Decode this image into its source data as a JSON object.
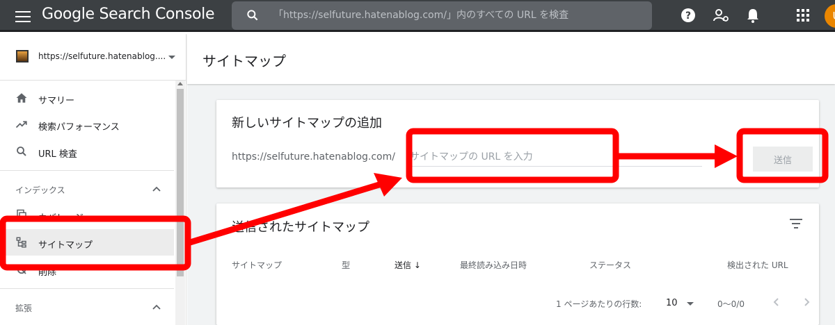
{
  "app": {
    "brand_google": "Google",
    "brand_product": "Search Console",
    "user_initial": "U"
  },
  "search": {
    "placeholder": "「https://selfuture.hatenablog.com/」内のすべての URL を検査"
  },
  "top_icons": [
    "help-icon",
    "manage-users-icon",
    "notifications-icon",
    "apps-grid-icon"
  ],
  "sidebar": {
    "property": "https://selfuture.hatenablog....",
    "items": [
      {
        "label": "サマリー",
        "icon": "home-icon"
      },
      {
        "label": "検索パフォーマンス",
        "icon": "trending-up-icon"
      },
      {
        "label": "URL 検査",
        "icon": "search-icon"
      }
    ],
    "index_section": "インデックス",
    "index_items": [
      {
        "label": "カバレッジ",
        "icon": "coverage-icon"
      },
      {
        "label": "サイトマップ",
        "icon": "sitemap-icon"
      },
      {
        "label": "削除",
        "icon": "removal-icon"
      }
    ],
    "ext_section": "拡張"
  },
  "page": {
    "title": "サイトマップ"
  },
  "add_card": {
    "title": "新しいサイトマップの追加",
    "prefix": "https://selfuture.hatenablog.com/",
    "placeholder": "サイトマップの URL を入力",
    "submit": "送信"
  },
  "submitted_card": {
    "title": "送信されたサイトマップ",
    "columns": [
      "サイトマップ",
      "型",
      "送信",
      "最終読み込み日時",
      "ステータス",
      "検出された URL"
    ],
    "sort_arrow": "↓",
    "rows_per_page_label": "1 ページあたりの行数:",
    "rows_per_page": "10",
    "range": "0〜0/0"
  },
  "colors": {
    "topbar": "#3c4043",
    "search": "#5f6368",
    "annotation": "#ff0000",
    "active_nav": "#ececec"
  }
}
